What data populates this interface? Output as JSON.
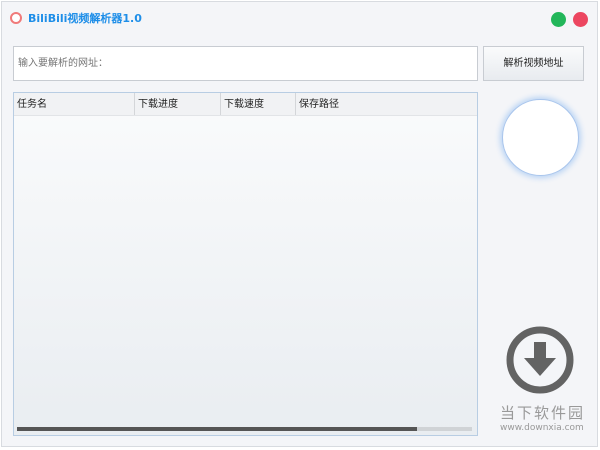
{
  "window": {
    "title": "BiliBili视频解析器1.0",
    "colors": {
      "title": "#1e8ee8",
      "maximize": "#22b65a",
      "close": "#ec4660"
    }
  },
  "url_input": {
    "placeholder": "输入要解析的网址：",
    "value": ""
  },
  "parse_button": {
    "label": "解析视频地址"
  },
  "table": {
    "columns": [
      "任务名",
      "下载进度",
      "下载速度",
      "保存路径"
    ],
    "rows": []
  },
  "watermark": {
    "name": "当下软件园",
    "url": "www.downxia.com"
  }
}
